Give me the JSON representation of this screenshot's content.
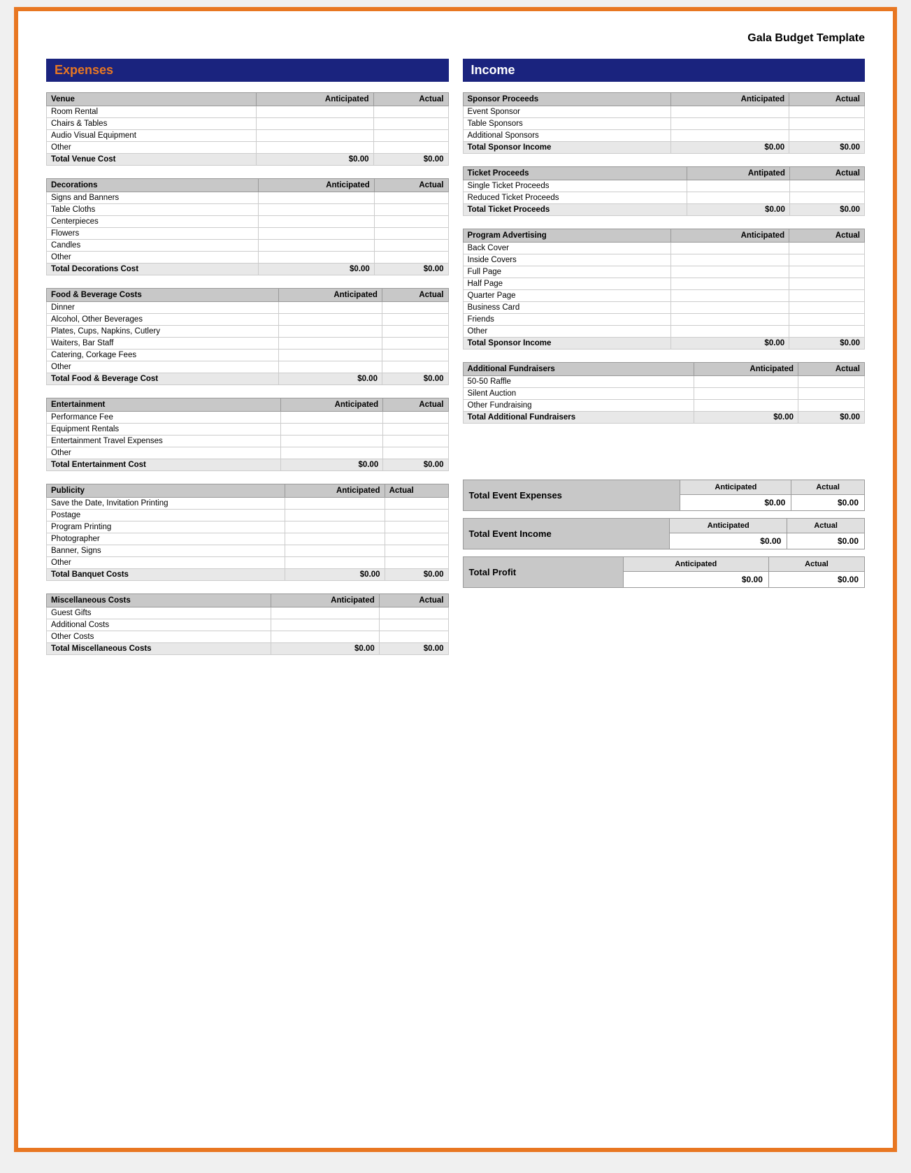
{
  "page": {
    "title": "Gala Budget Template",
    "border_color": "#e87722"
  },
  "expenses": {
    "header": "Expenses",
    "venue": {
      "label": "Venue",
      "col_anticipated": "Anticipated",
      "col_actual": "Actual",
      "rows": [
        "Room Rental",
        "Chairs & Tables",
        "Audio Visual Equipment",
        "Other"
      ],
      "total_label": "Total Venue Cost",
      "total_anticipated": "$0.00",
      "total_actual": "$0.00"
    },
    "decorations": {
      "label": "Decorations",
      "col_anticipated": "Anticipated",
      "col_actual": "Actual",
      "rows": [
        "Signs and Banners",
        "Table Cloths",
        "Centerpieces",
        "Flowers",
        "Candles",
        "Other"
      ],
      "total_label": "Total Decorations Cost",
      "total_anticipated": "$0.00",
      "total_actual": "$0.00"
    },
    "food": {
      "label": "Food & Beverage Costs",
      "col_anticipated": "Anticipated",
      "col_actual": "Actual",
      "rows": [
        "Dinner",
        "Alcohol, Other Beverages",
        "Plates, Cups, Napkins, Cutlery",
        "Waiters, Bar Staff",
        "Catering, Corkage Fees",
        "Other"
      ],
      "total_label": "Total Food & Beverage Cost",
      "total_anticipated": "$0.00",
      "total_actual": "$0.00"
    },
    "entertainment": {
      "label": "Entertainment",
      "col_anticipated": "Anticipated",
      "col_actual": "Actual",
      "rows": [
        "Performance Fee",
        "Equipment Rentals",
        "Entertainment Travel Expenses",
        "Other"
      ],
      "total_label": "Total Entertainment Cost",
      "total_anticipated": "$0.00",
      "total_actual": "$0.00"
    },
    "publicity": {
      "label": "Publicity",
      "col_anticipated": "Anticipated",
      "col_actual": "Actual",
      "rows": [
        "Save the Date, Invitation Printing",
        "Postage",
        "Program Printing",
        "Photographer",
        "Banner, Signs",
        "Other"
      ],
      "total_label": "Total Banquet Costs",
      "total_anticipated": "$0.00",
      "total_actual": "$0.00"
    },
    "miscellaneous": {
      "label": "Miscellaneous Costs",
      "col_anticipated": "Anticipated",
      "col_actual": "Actual",
      "rows": [
        "Guest Gifts",
        "Additional Costs",
        "Other Costs"
      ],
      "total_label": "Total Miscellaneous Costs",
      "total_anticipated": "$0.00",
      "total_actual": "$0.00"
    }
  },
  "income": {
    "header": "Income",
    "sponsor": {
      "label": "Sponsor Proceeds",
      "col_anticipated": "Anticipated",
      "col_actual": "Actual",
      "rows": [
        "Event Sponsor",
        "Table Sponsors",
        "Additional Sponsors"
      ],
      "total_label": "Total Sponsor Income",
      "total_anticipated": "$0.00",
      "total_actual": "$0.00"
    },
    "ticket": {
      "label": "Ticket Proceeds",
      "col_anticipated": "Antipated",
      "col_actual": "Actual",
      "rows": [
        "Single Ticket Proceeds",
        "Reduced Ticket Proceeds"
      ],
      "total_label": "Total Ticket Proceeds",
      "total_anticipated": "$0.00",
      "total_actual": "$0.00"
    },
    "advertising": {
      "label": "Program Advertising",
      "col_anticipated": "Anticipated",
      "col_actual": "Actual",
      "rows": [
        "Back Cover",
        "Inside Covers",
        "Full Page",
        "Half Page",
        "Quarter Page",
        "Business Card",
        "Friends",
        "Other"
      ],
      "total_label": "Total Sponsor Income",
      "total_anticipated": "$0.00",
      "total_actual": "$0.00"
    },
    "fundraisers": {
      "label": "Additional Fundraisers",
      "col_anticipated": "Anticipated",
      "col_actual": "Actual",
      "rows": [
        "50-50 Raffle",
        "Silent Auction",
        "Other Fundraising"
      ],
      "total_label": "Total Additional Fundraisers",
      "total_anticipated": "$0.00",
      "total_actual": "$0.00"
    }
  },
  "summary": {
    "total_expenses": {
      "label": "Total Event Expenses",
      "col_anticipated": "Anticipated",
      "col_actual": "Actual",
      "val_anticipated": "$0.00",
      "val_actual": "$0.00"
    },
    "total_income": {
      "label": "Total Event Income",
      "col_anticipated": "Anticipated",
      "col_actual": "Actual",
      "val_anticipated": "$0.00",
      "val_actual": "$0.00"
    },
    "total_profit": {
      "label": "Total Profit",
      "col_anticipated": "Anticipated",
      "col_actual": "Actual",
      "val_anticipated": "$0.00",
      "val_actual": "$0.00"
    }
  }
}
